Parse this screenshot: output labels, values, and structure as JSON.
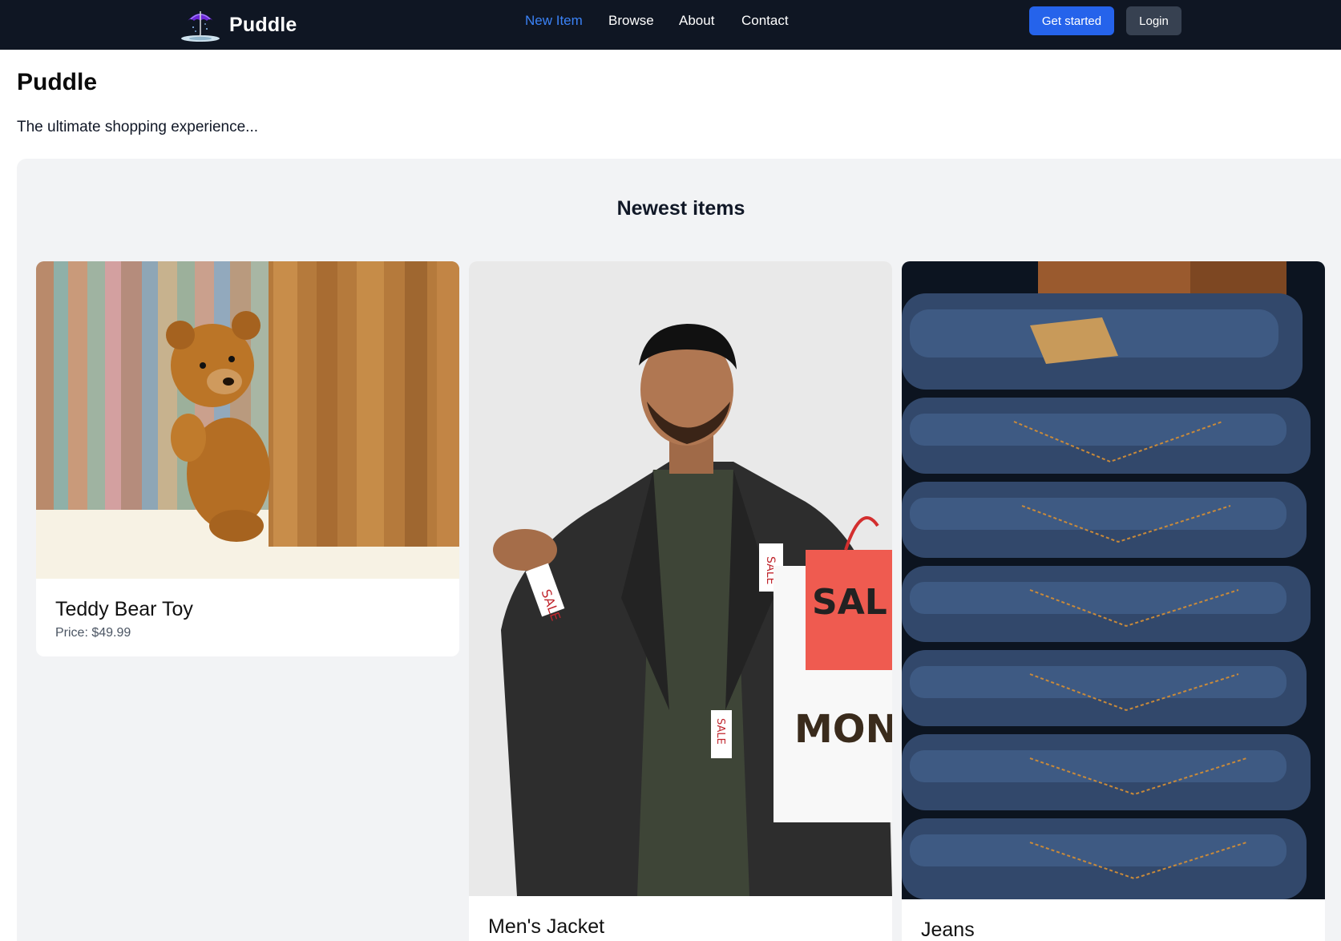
{
  "nav": {
    "brand": "Puddle",
    "links": [
      "New Item",
      "Browse",
      "About",
      "Contact"
    ],
    "active_link": "New Item",
    "get_started": "Get started",
    "login": "Login"
  },
  "header": {
    "title": "Puddle",
    "tagline": "The ultimate shopping experience..."
  },
  "section": {
    "title": "Newest items"
  },
  "items": [
    {
      "name": "Teddy Bear Toy",
      "price": "Price: $49.99",
      "image": "teddy-bear-photo"
    },
    {
      "name": "Men's Jacket",
      "price": "",
      "image": "mens-jacket-photo"
    },
    {
      "name": "Jeans",
      "price": "",
      "image": "jeans-photo"
    }
  ],
  "colors": {
    "nav_bg": "#0f1623",
    "accent": "#3b82f6",
    "primary_button": "#2563eb",
    "secondary_button": "#374151",
    "panel_bg": "#f2f3f5"
  }
}
